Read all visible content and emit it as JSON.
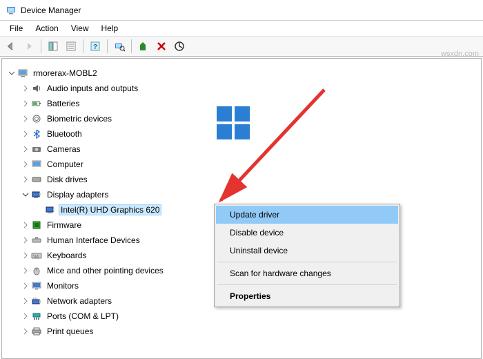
{
  "window": {
    "title": "Device Manager"
  },
  "menu": {
    "file": "File",
    "action": "Action",
    "view": "View",
    "help": "Help"
  },
  "tree": {
    "root": "rmorerax-MOBL2",
    "items": [
      "Audio inputs and outputs",
      "Batteries",
      "Biometric devices",
      "Bluetooth",
      "Cameras",
      "Computer",
      "Disk drives",
      "Display adapters",
      "Intel(R) UHD Graphics 620",
      "Firmware",
      "Human Interface Devices",
      "Keyboards",
      "Mice and other pointing devices",
      "Monitors",
      "Network adapters",
      "Ports (COM & LPT)",
      "Print queues"
    ]
  },
  "context_menu": {
    "update": "Update driver",
    "disable": "Disable device",
    "uninstall": "Uninstall device",
    "scan": "Scan for hardware changes",
    "properties": "Properties"
  },
  "watermark": "wsxdn.com"
}
